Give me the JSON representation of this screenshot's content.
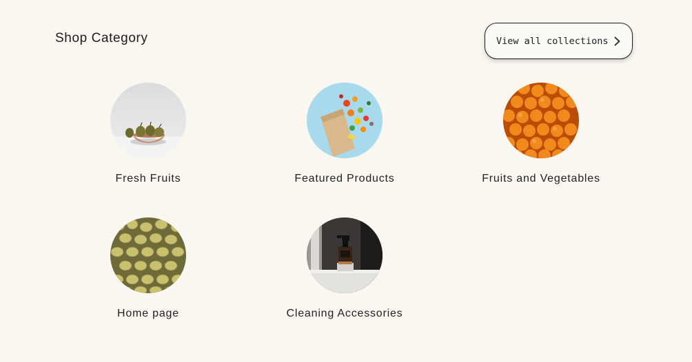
{
  "section": {
    "title": "Shop Category",
    "view_all_label": "View all collections"
  },
  "categories": [
    {
      "label": "Fresh Fruits",
      "image": "pears-in-bowl"
    },
    {
      "label": "Featured Products",
      "image": "grocery-bag-vegetables"
    },
    {
      "label": "Fruits and Vegetables",
      "image": "pile-of-oranges"
    },
    {
      "label": "Home page",
      "image": "pile-of-potatoes"
    },
    {
      "label": "Cleaning Accessories",
      "image": "spray-bottle"
    }
  ],
  "colors": {
    "background": "#f9f7f0",
    "text": "#1f1f1f",
    "button_border": "#1b1b1b"
  }
}
